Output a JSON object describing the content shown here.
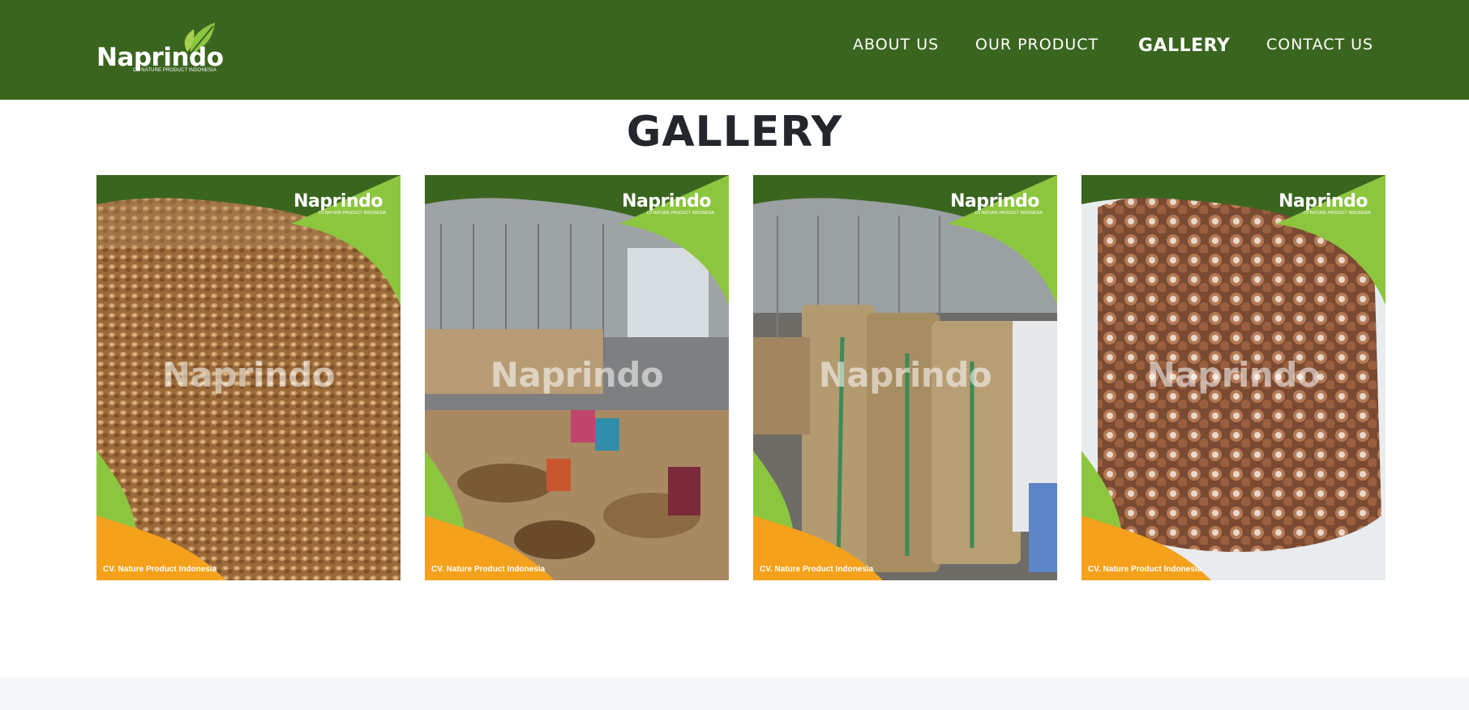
{
  "brand": {
    "name": "Naprindo",
    "tagline": "CV NATURE PRODUCT INDONESIA",
    "colors": {
      "header": "#3a651f",
      "accent_light": "#8cc63f",
      "accent_orange": "#f5a11b"
    }
  },
  "nav": {
    "items": [
      {
        "label": "ABOUT US",
        "active": false
      },
      {
        "label": "OUR PRODUCT",
        "active": false
      },
      {
        "label": "GALLERY",
        "active": true
      },
      {
        "label": "CONTACT US",
        "active": false
      }
    ]
  },
  "page": {
    "title": "GALLERY"
  },
  "gallery": {
    "items": [
      {
        "caption": "CV. Nature Product Indonesia",
        "brand": "Naprindo",
        "brand_sub": "CV NATURE PRODUCT INDONESIA",
        "watermark": "Naprindo",
        "subject": "dried-nuts-pile"
      },
      {
        "caption": "CV. Nature Product Indonesia",
        "brand": "Naprindo",
        "brand_sub": "CV NATURE PRODUCT INDONESIA",
        "watermark": "Naprindo",
        "subject": "workers-sorting"
      },
      {
        "caption": "CV. Nature Product Indonesia",
        "brand": "Naprindo",
        "brand_sub": "CV NATURE PRODUCT INDONESIA",
        "watermark": "Naprindo",
        "subject": "jute-sacks"
      },
      {
        "caption": "CV. Nature Product Indonesia",
        "brand": "Naprindo",
        "brand_sub": "CV NATURE PRODUCT INDONESIA",
        "watermark": "Naprindo",
        "subject": "nuts-in-bag"
      }
    ]
  }
}
